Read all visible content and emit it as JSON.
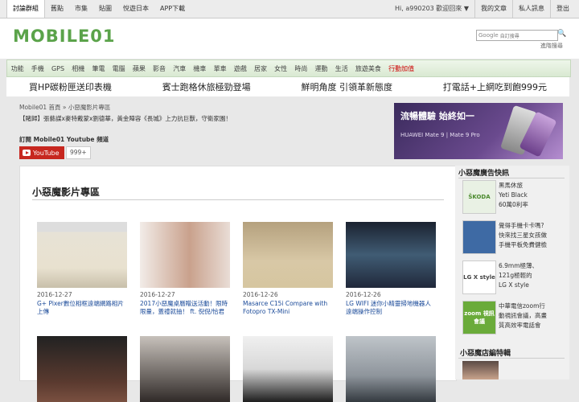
{
  "topnav": {
    "left": [
      "討論群組",
      "舊點",
      "市集",
      "貼圖",
      "悅遊日本",
      "APP下載"
    ],
    "greeting": "Hi, a990203 歡迎回來 ▼",
    "right": [
      "我的文章",
      "私人訊息",
      "登出"
    ]
  },
  "logo": {
    "text": "MOBILE01"
  },
  "search": {
    "google_label": "Google",
    "placeholder": "自訂搜尋",
    "advanced": "進階搜尋"
  },
  "categories": [
    {
      "label": "功能"
    },
    {
      "label": "手機"
    },
    {
      "label": "GPS"
    },
    {
      "label": "相機"
    },
    {
      "label": "筆電"
    },
    {
      "label": "電腦"
    },
    {
      "label": "蘋果"
    },
    {
      "label": "影音"
    },
    {
      "label": "汽車"
    },
    {
      "label": "機車"
    },
    {
      "label": "單車"
    },
    {
      "label": "遊戲"
    },
    {
      "label": "居家"
    },
    {
      "label": "女性"
    },
    {
      "label": "時尚"
    },
    {
      "label": "運動"
    },
    {
      "label": "生活"
    },
    {
      "label": "旅遊美食"
    },
    {
      "label": "行動加值",
      "highlight": true
    }
  ],
  "promo": [
    "買HP碳粉匣送印表機",
    "賓士跑格休旅極勁登場",
    "鮮明角度 引領革新態度",
    "打電話+上網吃到飽999元"
  ],
  "breadcrumb": "Mobile01 首頁 » 小惡魔影片專區",
  "headline": "【賭歸】張藝謀x麥特戴蒙x劉德華，黃金陣容《長城》上力抗巨獸，守衛家園！",
  "subscribe": {
    "label": "訂閱 Mobile01 Youtube 頻道",
    "yt_label": "YouTube",
    "count": "999+"
  },
  "banner": {
    "title": "流暢體驗 始終如一",
    "subtitle": "HUAWEI Mate 9 | Mate 9 Pro"
  },
  "main": {
    "title": "小惡魔影片專區",
    "videos": [
      {
        "date": "2016-12-27",
        "title": "G+ Pixer數位相框遠端網路相片上傳"
      },
      {
        "date": "2016-12-27",
        "title": "2017小惡魔桌曆贈送活動！限時限量，蓋禮就抽！ ft. 倪倪/恰君"
      },
      {
        "date": "2016-12-26",
        "title": "Masarce C15i Compare with Fotopro TX-Mini"
      },
      {
        "date": "2016-12-26",
        "title": "LG WIFI 迷你小精靈掃地機器人 遠端操作控制"
      },
      {
        "date": "",
        "title": ""
      },
      {
        "date": "",
        "title": ""
      },
      {
        "date": "",
        "title": ""
      },
      {
        "date": "",
        "title": ""
      }
    ]
  },
  "sidebar": {
    "ads_title": "小惡魔廣告快訊",
    "ads": [
      {
        "lines": [
          "黑馬休旅",
          "Yeti Black",
          "60萬0利率"
        ],
        "logo": "ŠKODA",
        "color": "#e9f1e4"
      },
      {
        "lines": [
          "覺得手機卡卡嗎?",
          "快來找三星女孩做",
          "手機平板免費健檢"
        ],
        "logo": "",
        "color": "#3e6aa4"
      },
      {
        "lines": [
          "6.9mm極薄、",
          "121g極輕的",
          "LG X style"
        ],
        "logo": "LG X style",
        "color": "#ffffff"
      },
      {
        "lines": [
          "中華電信zoom行",
          "動視訊會議，高畫",
          "質高效率電話會"
        ],
        "logo": "zoom 視訊會議",
        "color": "#6aab3a"
      }
    ],
    "editors_title": "小惡魔店編特輯"
  }
}
